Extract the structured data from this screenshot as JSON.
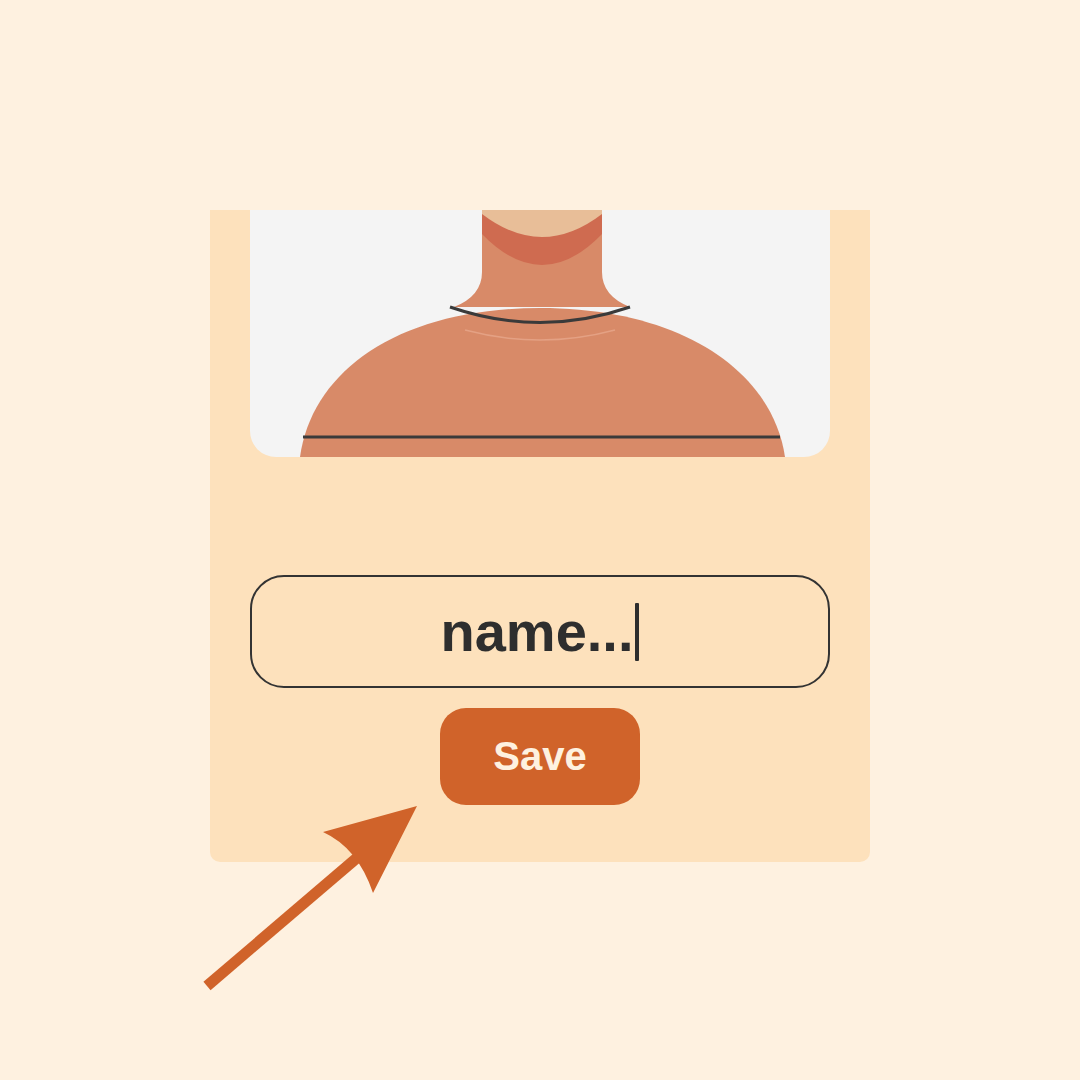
{
  "card": {
    "field": {
      "value": "name...",
      "focused": true
    },
    "button": {
      "label": "Save"
    }
  }
}
